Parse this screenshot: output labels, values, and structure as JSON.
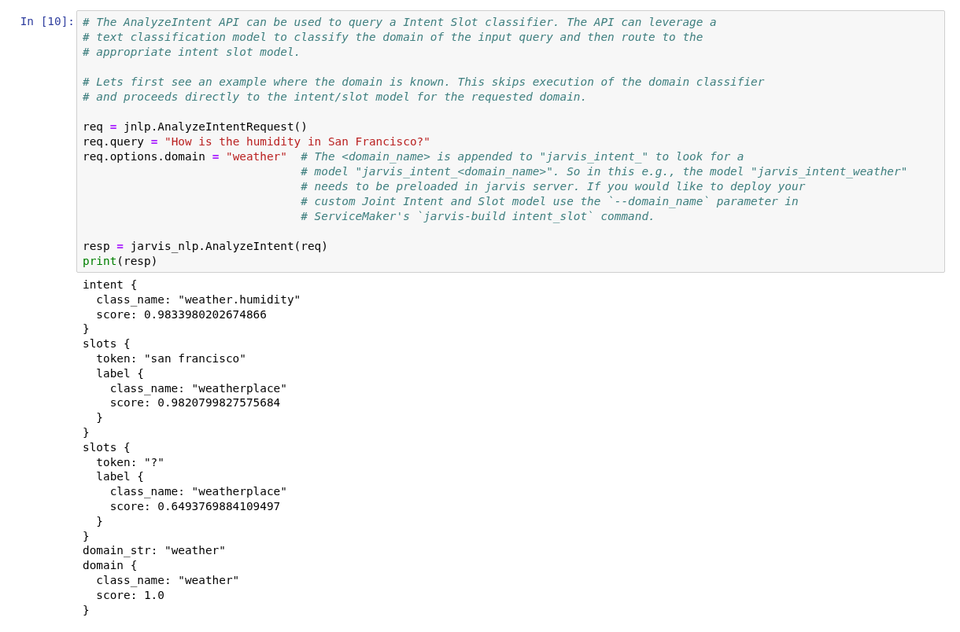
{
  "cell": {
    "prompt": "In [10]:",
    "code": [
      {
        "kind": "code",
        "tokens": [
          {
            "kind": "comment",
            "text": "# The AnalyzeIntent API can be used to query a Intent Slot classifier. The API can leverage a"
          }
        ]
      },
      {
        "kind": "code",
        "tokens": [
          {
            "kind": "comment",
            "text": "# text classification model to classify the domain of the input query and then route to the"
          }
        ]
      },
      {
        "kind": "code",
        "tokens": [
          {
            "kind": "comment",
            "text": "# appropriate intent slot model."
          }
        ]
      },
      {
        "kind": "blank"
      },
      {
        "kind": "code",
        "tokens": [
          {
            "kind": "comment",
            "text": "# Lets first see an example where the domain is known. This skips execution of the domain classifier"
          }
        ]
      },
      {
        "kind": "code",
        "tokens": [
          {
            "kind": "comment",
            "text": "# and proceeds directly to the intent/slot model for the requested domain."
          }
        ]
      },
      {
        "kind": "blank"
      },
      {
        "kind": "code",
        "tokens": [
          {
            "kind": "name",
            "text": "req"
          },
          {
            "kind": "operator",
            "text": "="
          },
          {
            "kind": "name",
            "text": "jnlp.AnalyzeIntentRequest()"
          }
        ]
      },
      {
        "kind": "code",
        "tokens": [
          {
            "kind": "name",
            "text": "req.query"
          },
          {
            "kind": "operator",
            "text": "="
          },
          {
            "kind": "string",
            "text": "\"How is the humidity in San Francisco?\""
          }
        ]
      },
      {
        "kind": "code",
        "tokens": [
          {
            "kind": "name",
            "text": "req.options.domain"
          },
          {
            "kind": "operator",
            "text": "="
          },
          {
            "kind": "string",
            "text": "\"weather\""
          },
          {
            "kind": "comment",
            "text": "# The <domain_name> is appended to \"jarvis_intent_\" to look for a"
          }
        ]
      },
      {
        "kind": "continuation",
        "tokens": [
          {
            "kind": "comment",
            "text": "# model \"jarvis_intent_<domain_name>\". So in this e.g., the model \"jarvis_intent_weather\""
          }
        ]
      },
      {
        "kind": "continuation",
        "tokens": [
          {
            "kind": "comment",
            "text": "# needs to be preloaded in jarvis server. If you would like to deploy your"
          }
        ]
      },
      {
        "kind": "continuation",
        "tokens": [
          {
            "kind": "comment",
            "text": "# custom Joint Intent and Slot model use the `--domain_name` parameter in"
          }
        ]
      },
      {
        "kind": "continuation",
        "tokens": [
          {
            "kind": "comment",
            "text": "# ServiceMaker's `jarvis-build intent_slot` command."
          }
        ]
      },
      {
        "kind": "blank"
      },
      {
        "kind": "code",
        "tokens": [
          {
            "kind": "name",
            "text": "resp"
          },
          {
            "kind": "operator",
            "text": "="
          },
          {
            "kind": "name",
            "text": "jarvis_nlp.AnalyzeIntent(req)"
          }
        ]
      },
      {
        "kind": "code",
        "tokens": [
          {
            "kind": "builtin",
            "text": "print"
          },
          {
            "kind": "name",
            "text": "(resp)"
          }
        ]
      }
    ],
    "output": [
      {
        "text": "intent {",
        "children": [
          {
            "text": "class_name: \"weather.humidity\""
          },
          {
            "text": "score: 0.9833980202674866"
          }
        ]
      },
      {
        "text": "}"
      },
      {
        "text": "slots {",
        "children": [
          {
            "text": "token: \"san francisco\""
          },
          {
            "text": "label {",
            "children": [
              {
                "text": "class_name: \"weatherplace\""
              },
              {
                "text": "score: 0.9820799827575684"
              }
            ]
          },
          {
            "text": "}"
          }
        ]
      },
      {
        "text": "}"
      },
      {
        "text": "slots {",
        "children": [
          {
            "text": "token: \"?\""
          },
          {
            "text": "label {",
            "children": [
              {
                "text": "class_name: \"weatherplace\""
              },
              {
                "text": "score: 0.6493769884109497"
              }
            ]
          },
          {
            "text": "}"
          }
        ]
      },
      {
        "text": "}"
      },
      {
        "text": "domain_str: \"weather\""
      },
      {
        "text": "domain {",
        "children": [
          {
            "text": "class_name: \"weather\""
          },
          {
            "text": "score: 1.0"
          }
        ]
      },
      {
        "text": "}"
      }
    ]
  }
}
